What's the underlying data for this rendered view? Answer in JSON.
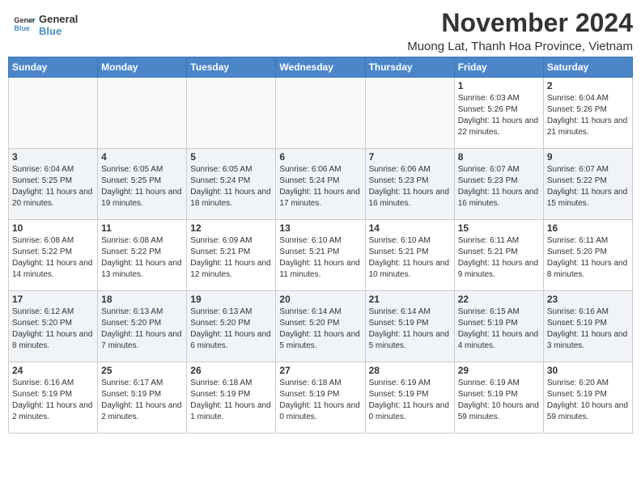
{
  "logo": {
    "line1": "General",
    "line2": "Blue"
  },
  "title": "November 2024",
  "location": "Muong Lat, Thanh Hoa Province, Vietnam",
  "days_of_week": [
    "Sunday",
    "Monday",
    "Tuesday",
    "Wednesday",
    "Thursday",
    "Friday",
    "Saturday"
  ],
  "weeks": [
    [
      {
        "day": "",
        "info": ""
      },
      {
        "day": "",
        "info": ""
      },
      {
        "day": "",
        "info": ""
      },
      {
        "day": "",
        "info": ""
      },
      {
        "day": "",
        "info": ""
      },
      {
        "day": "1",
        "info": "Sunrise: 6:03 AM\nSunset: 5:26 PM\nDaylight: 11 hours and 22 minutes."
      },
      {
        "day": "2",
        "info": "Sunrise: 6:04 AM\nSunset: 5:26 PM\nDaylight: 11 hours and 21 minutes."
      }
    ],
    [
      {
        "day": "3",
        "info": "Sunrise: 6:04 AM\nSunset: 5:25 PM\nDaylight: 11 hours and 20 minutes."
      },
      {
        "day": "4",
        "info": "Sunrise: 6:05 AM\nSunset: 5:25 PM\nDaylight: 11 hours and 19 minutes."
      },
      {
        "day": "5",
        "info": "Sunrise: 6:05 AM\nSunset: 5:24 PM\nDaylight: 11 hours and 18 minutes."
      },
      {
        "day": "6",
        "info": "Sunrise: 6:06 AM\nSunset: 5:24 PM\nDaylight: 11 hours and 17 minutes."
      },
      {
        "day": "7",
        "info": "Sunrise: 6:06 AM\nSunset: 5:23 PM\nDaylight: 11 hours and 16 minutes."
      },
      {
        "day": "8",
        "info": "Sunrise: 6:07 AM\nSunset: 5:23 PM\nDaylight: 11 hours and 16 minutes."
      },
      {
        "day": "9",
        "info": "Sunrise: 6:07 AM\nSunset: 5:22 PM\nDaylight: 11 hours and 15 minutes."
      }
    ],
    [
      {
        "day": "10",
        "info": "Sunrise: 6:08 AM\nSunset: 5:22 PM\nDaylight: 11 hours and 14 minutes."
      },
      {
        "day": "11",
        "info": "Sunrise: 6:08 AM\nSunset: 5:22 PM\nDaylight: 11 hours and 13 minutes."
      },
      {
        "day": "12",
        "info": "Sunrise: 6:09 AM\nSunset: 5:21 PM\nDaylight: 11 hours and 12 minutes."
      },
      {
        "day": "13",
        "info": "Sunrise: 6:10 AM\nSunset: 5:21 PM\nDaylight: 11 hours and 11 minutes."
      },
      {
        "day": "14",
        "info": "Sunrise: 6:10 AM\nSunset: 5:21 PM\nDaylight: 11 hours and 10 minutes."
      },
      {
        "day": "15",
        "info": "Sunrise: 6:11 AM\nSunset: 5:21 PM\nDaylight: 11 hours and 9 minutes."
      },
      {
        "day": "16",
        "info": "Sunrise: 6:11 AM\nSunset: 5:20 PM\nDaylight: 11 hours and 8 minutes."
      }
    ],
    [
      {
        "day": "17",
        "info": "Sunrise: 6:12 AM\nSunset: 5:20 PM\nDaylight: 11 hours and 8 minutes."
      },
      {
        "day": "18",
        "info": "Sunrise: 6:13 AM\nSunset: 5:20 PM\nDaylight: 11 hours and 7 minutes."
      },
      {
        "day": "19",
        "info": "Sunrise: 6:13 AM\nSunset: 5:20 PM\nDaylight: 11 hours and 6 minutes."
      },
      {
        "day": "20",
        "info": "Sunrise: 6:14 AM\nSunset: 5:20 PM\nDaylight: 11 hours and 5 minutes."
      },
      {
        "day": "21",
        "info": "Sunrise: 6:14 AM\nSunset: 5:19 PM\nDaylight: 11 hours and 5 minutes."
      },
      {
        "day": "22",
        "info": "Sunrise: 6:15 AM\nSunset: 5:19 PM\nDaylight: 11 hours and 4 minutes."
      },
      {
        "day": "23",
        "info": "Sunrise: 6:16 AM\nSunset: 5:19 PM\nDaylight: 11 hours and 3 minutes."
      }
    ],
    [
      {
        "day": "24",
        "info": "Sunrise: 6:16 AM\nSunset: 5:19 PM\nDaylight: 11 hours and 2 minutes."
      },
      {
        "day": "25",
        "info": "Sunrise: 6:17 AM\nSunset: 5:19 PM\nDaylight: 11 hours and 2 minutes."
      },
      {
        "day": "26",
        "info": "Sunrise: 6:18 AM\nSunset: 5:19 PM\nDaylight: 11 hours and 1 minute."
      },
      {
        "day": "27",
        "info": "Sunrise: 6:18 AM\nSunset: 5:19 PM\nDaylight: 11 hours and 0 minutes."
      },
      {
        "day": "28",
        "info": "Sunrise: 6:19 AM\nSunset: 5:19 PM\nDaylight: 11 hours and 0 minutes."
      },
      {
        "day": "29",
        "info": "Sunrise: 6:19 AM\nSunset: 5:19 PM\nDaylight: 10 hours and 59 minutes."
      },
      {
        "day": "30",
        "info": "Sunrise: 6:20 AM\nSunset: 5:19 PM\nDaylight: 10 hours and 59 minutes."
      }
    ]
  ]
}
